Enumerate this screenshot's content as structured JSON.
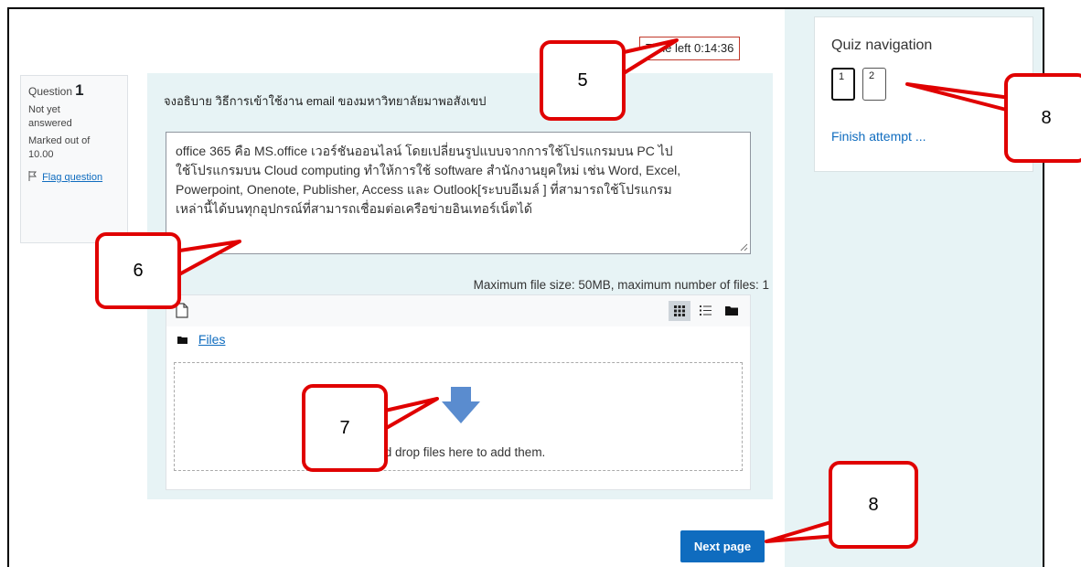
{
  "timer": {
    "label": "Time left 0:14:36"
  },
  "question_info": {
    "label": "Question",
    "number": "1",
    "status_line1": "Not yet",
    "status_line2": "answered",
    "marked_line1": "Marked out of",
    "marked_line2": "10.00",
    "flag_label": "Flag question"
  },
  "question": {
    "text": "จงอธิบาย วิธีการเข้าใช้งาน email ของมหาวิทยาลัยมาพอสังเขป",
    "answer_lines": [
      "office 365 คือ MS.office เวอร์ชันออนไลน์ โดยเปลี่ยนรูปแบบจากการใช้โปรแกรมบน PC ไป",
      "ใช้โปรแกรมบน Cloud computing ทำให้การใช้ software สำนักงานยุคใหม่ เช่น Word, Excel,",
      "Powerpoint, Onenote, Publisher, Access และ Outlook[ระบบอีเมล์ ] ที่สามารถใช้โปรแกรม",
      "เหล่านี้ได้บนทุกอุปกรณ์ที่สามารถเชื่อมต่อเครือข่ายอินเทอร์เน็ตได้"
    ]
  },
  "file_manager": {
    "limits_text": "Maximum file size: 50MB, maximum number of files: 1",
    "path_label": "Files",
    "drop_text": "and drop files here to add them.",
    "view_icons": [
      "grid-view-icon",
      "list-view-icon",
      "tree-view-icon"
    ],
    "active_view": "grid-view-icon"
  },
  "quiz_navigation": {
    "title": "Quiz navigation",
    "buttons": [
      "1",
      "2"
    ],
    "current": "1",
    "finish_label": "Finish attempt ..."
  },
  "next_button": {
    "label": "Next page"
  },
  "callouts": {
    "c5": "5",
    "c6": "6",
    "c7": "7",
    "c8a": "8",
    "c8b": "8"
  },
  "colors": {
    "accent": "#0f6cbf",
    "panel_bg": "#e7f3f5",
    "callout_red": "#e00000",
    "timer_border": "#c0392b"
  }
}
